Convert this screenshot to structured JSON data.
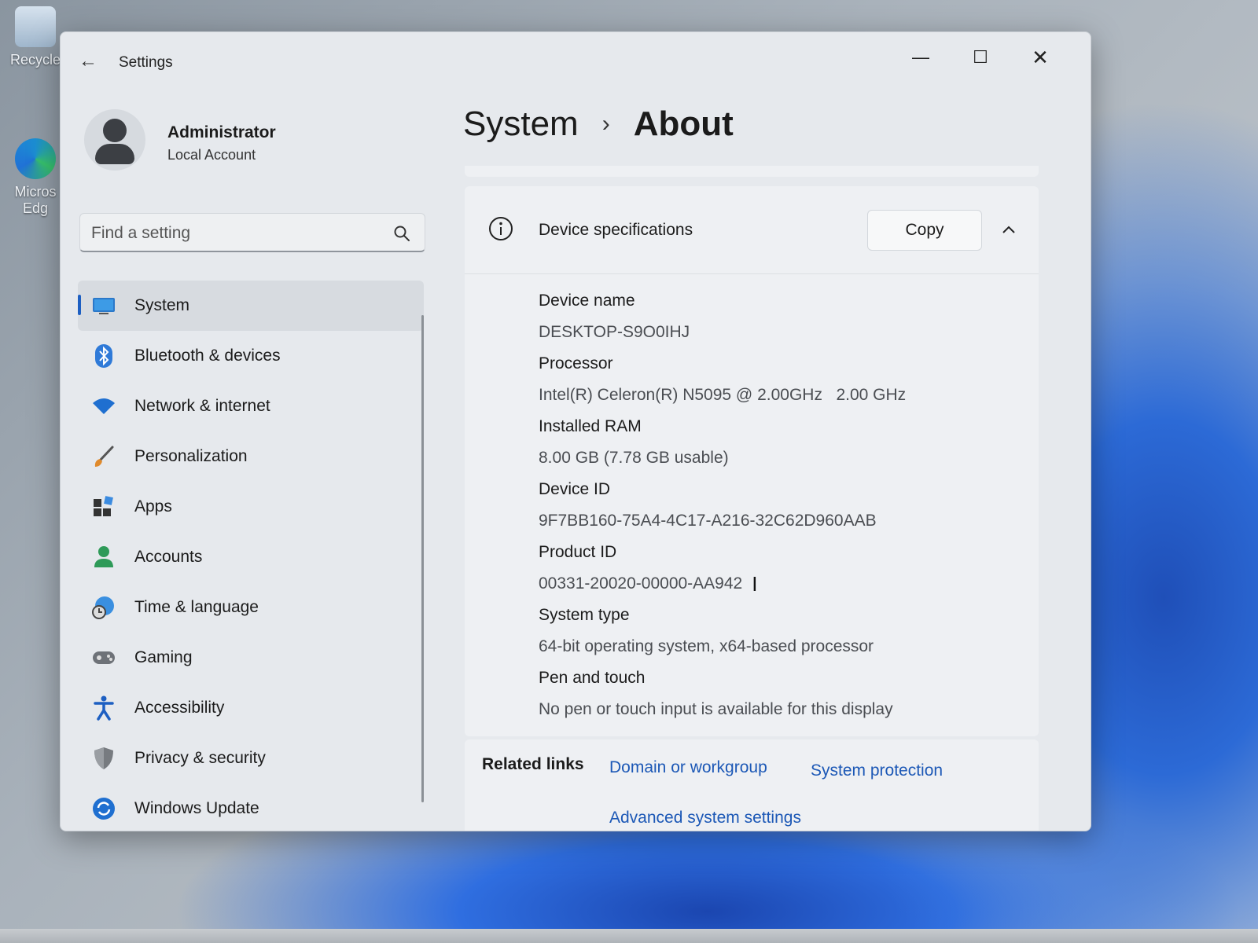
{
  "desktop": {
    "icons": [
      {
        "label": "Recycle"
      },
      {
        "label": "Micros Edg"
      }
    ]
  },
  "window": {
    "title": "Settings",
    "controls": {
      "minimize": "—",
      "maximize": "☐",
      "close": "✕"
    }
  },
  "user": {
    "name": "Administrator",
    "account_type": "Local Account"
  },
  "search": {
    "placeholder": "Find a setting"
  },
  "sidebar": {
    "items": [
      {
        "label": "System",
        "icon": "monitor-icon",
        "active": true
      },
      {
        "label": "Bluetooth & devices",
        "icon": "bluetooth-icon"
      },
      {
        "label": "Network & internet",
        "icon": "wifi-icon"
      },
      {
        "label": "Personalization",
        "icon": "brush-icon"
      },
      {
        "label": "Apps",
        "icon": "apps-icon"
      },
      {
        "label": "Accounts",
        "icon": "person-icon"
      },
      {
        "label": "Time & language",
        "icon": "globe-clock-icon"
      },
      {
        "label": "Gaming",
        "icon": "gamepad-icon"
      },
      {
        "label": "Accessibility",
        "icon": "accessibility-icon"
      },
      {
        "label": "Privacy & security",
        "icon": "shield-icon"
      },
      {
        "label": "Windows Update",
        "icon": "update-icon"
      }
    ]
  },
  "breadcrumb": {
    "parent": "System",
    "separator": "›",
    "current": "About"
  },
  "device_specs": {
    "title": "Device specifications",
    "copy_label": "Copy",
    "rows": [
      {
        "label": "Device name",
        "value": "DESKTOP-S9O0IHJ"
      },
      {
        "label": "Processor",
        "value": "Intel(R) Celeron(R) N5095 @ 2.00GHz   2.00 GHz"
      },
      {
        "label": "Installed RAM",
        "value": "8.00 GB (7.78 GB usable)"
      },
      {
        "label": "Device ID",
        "value": "9F7BB160-75A4-4C17-A216-32C62D960AAB"
      },
      {
        "label": "Product ID",
        "value": "00331-20020-00000-AA942"
      },
      {
        "label": "System type",
        "value": "64-bit operating system, x64-based processor"
      },
      {
        "label": "Pen and touch",
        "value": "No pen or touch input is available for this display"
      }
    ]
  },
  "related_links": {
    "title": "Related links",
    "links": [
      "Domain or workgroup",
      "System protection",
      "Advanced system settings"
    ]
  },
  "colors": {
    "accent": "#1d5fc2",
    "link": "#1c58b6",
    "window_bg": "#e6e9ed",
    "card_bg": "#eef0f3"
  }
}
